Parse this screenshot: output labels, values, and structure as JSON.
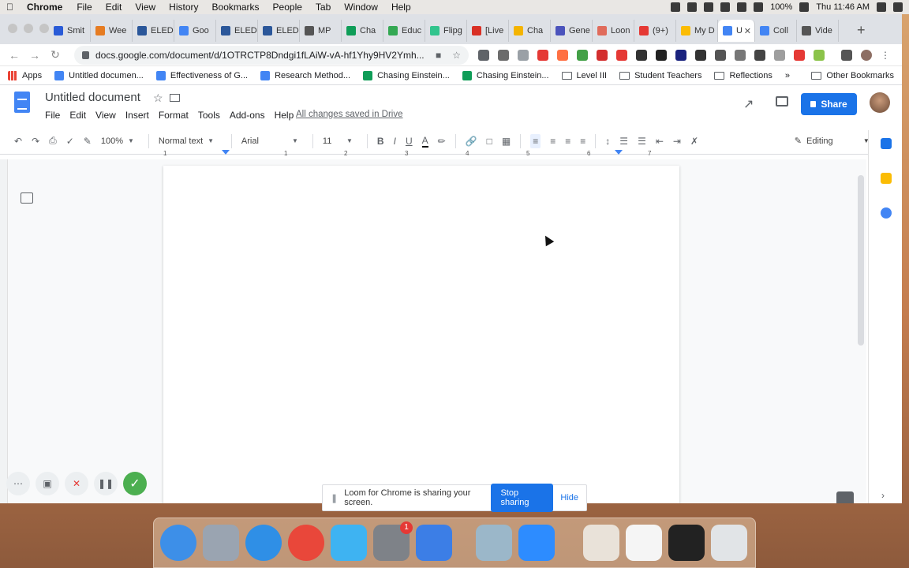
{
  "menubar": {
    "app": "Chrome",
    "items": [
      "File",
      "Edit",
      "View",
      "History",
      "Bookmarks",
      "People",
      "Tab",
      "Window",
      "Help"
    ],
    "battery": "100%",
    "clock": "Thu 11:46 AM"
  },
  "tabs": [
    {
      "label": "Smit",
      "color": "#2a5bd7"
    },
    {
      "label": "Wee",
      "color": "#e67c22"
    },
    {
      "label": "ELED",
      "color": "#2b579a"
    },
    {
      "label": "Goo",
      "color": "#4285f4"
    },
    {
      "label": "ELED",
      "color": "#2b579a"
    },
    {
      "label": "ELED",
      "color": "#2b579a"
    },
    {
      "label": "MP",
      "color": "#555555"
    },
    {
      "label": "Cha",
      "color": "#0f9d58"
    },
    {
      "label": "Educ",
      "color": "#34a853"
    },
    {
      "label": "Flipg",
      "color": "#31c48d"
    },
    {
      "label": "[Live",
      "color": "#d93025"
    },
    {
      "label": "Cha",
      "color": "#f4b400"
    },
    {
      "label": "Gene",
      "color": "#4b53bc"
    },
    {
      "label": "Loon",
      "color": "#e06b5b"
    },
    {
      "label": "(9+)",
      "color": "#e53935"
    },
    {
      "label": "My D",
      "color": "#fbbc04"
    },
    {
      "label": "U",
      "color": "#4285f4",
      "active": true
    },
    {
      "label": "Coll",
      "color": "#4285f4"
    },
    {
      "label": "Vide",
      "color": "#555555"
    }
  ],
  "url": "docs.google.com/document/d/1OTRCTP8Dndgi1fLAiW-vA-hf1Yhy9HV2Ymh...",
  "bookmarks": [
    {
      "label": "Apps",
      "type": "apps",
      "color": "#ea4335"
    },
    {
      "label": "Untitled documen...",
      "type": "doc",
      "color": "#4285f4"
    },
    {
      "label": "Effectiveness of G...",
      "type": "doc",
      "color": "#4285f4"
    },
    {
      "label": "Research Method...",
      "type": "doc",
      "color": "#4285f4"
    },
    {
      "label": "Chasing Einstein...",
      "type": "sheet",
      "color": "#0f9d58"
    },
    {
      "label": "Chasing Einstein...",
      "type": "sheet",
      "color": "#0f9d58"
    },
    {
      "label": "Level III",
      "type": "folder"
    },
    {
      "label": "Student Teachers",
      "type": "folder"
    },
    {
      "label": "Reflections",
      "type": "folder"
    },
    {
      "label": "Other Bookmarks",
      "type": "folder"
    }
  ],
  "docs": {
    "title": "Untitled document",
    "menu": [
      "File",
      "Edit",
      "View",
      "Insert",
      "Format",
      "Tools",
      "Add-ons",
      "Help"
    ],
    "save_status": "All changes saved in Drive",
    "share": "Share",
    "zoom": "100%",
    "style": "Normal text",
    "font": "Arial",
    "size": "11",
    "mode": "Editing",
    "ruler": [
      "1",
      "1",
      "2",
      "3",
      "4",
      "5",
      "6",
      "7"
    ]
  },
  "loom": {
    "message": "Loom for Chrome is sharing your screen.",
    "stop": "Stop sharing",
    "hide": "Hide"
  },
  "dock": [
    {
      "name": "finder",
      "color": "#3d8fe8"
    },
    {
      "name": "launchpad",
      "color": "#9aa4b1"
    },
    {
      "name": "safari",
      "color": "#2f8fe6"
    },
    {
      "name": "chrome",
      "color": "#e9473a"
    },
    {
      "name": "messages",
      "color": "#3eb3f2"
    },
    {
      "name": "system-preferences",
      "color": "#7e8288",
      "badge": "1"
    },
    {
      "name": "keynote",
      "color": "#3c7ee6"
    },
    {
      "name": "preview",
      "color": "#9bb7c9"
    },
    {
      "name": "zoom",
      "color": "#2d8cff"
    },
    {
      "name": "doc-window",
      "color": "#e9e2d9"
    },
    {
      "name": "blank-window",
      "color": "#f5f5f5"
    },
    {
      "name": "terminal-window",
      "color": "#222222"
    },
    {
      "name": "trash",
      "color": "#e1e4e7"
    }
  ]
}
